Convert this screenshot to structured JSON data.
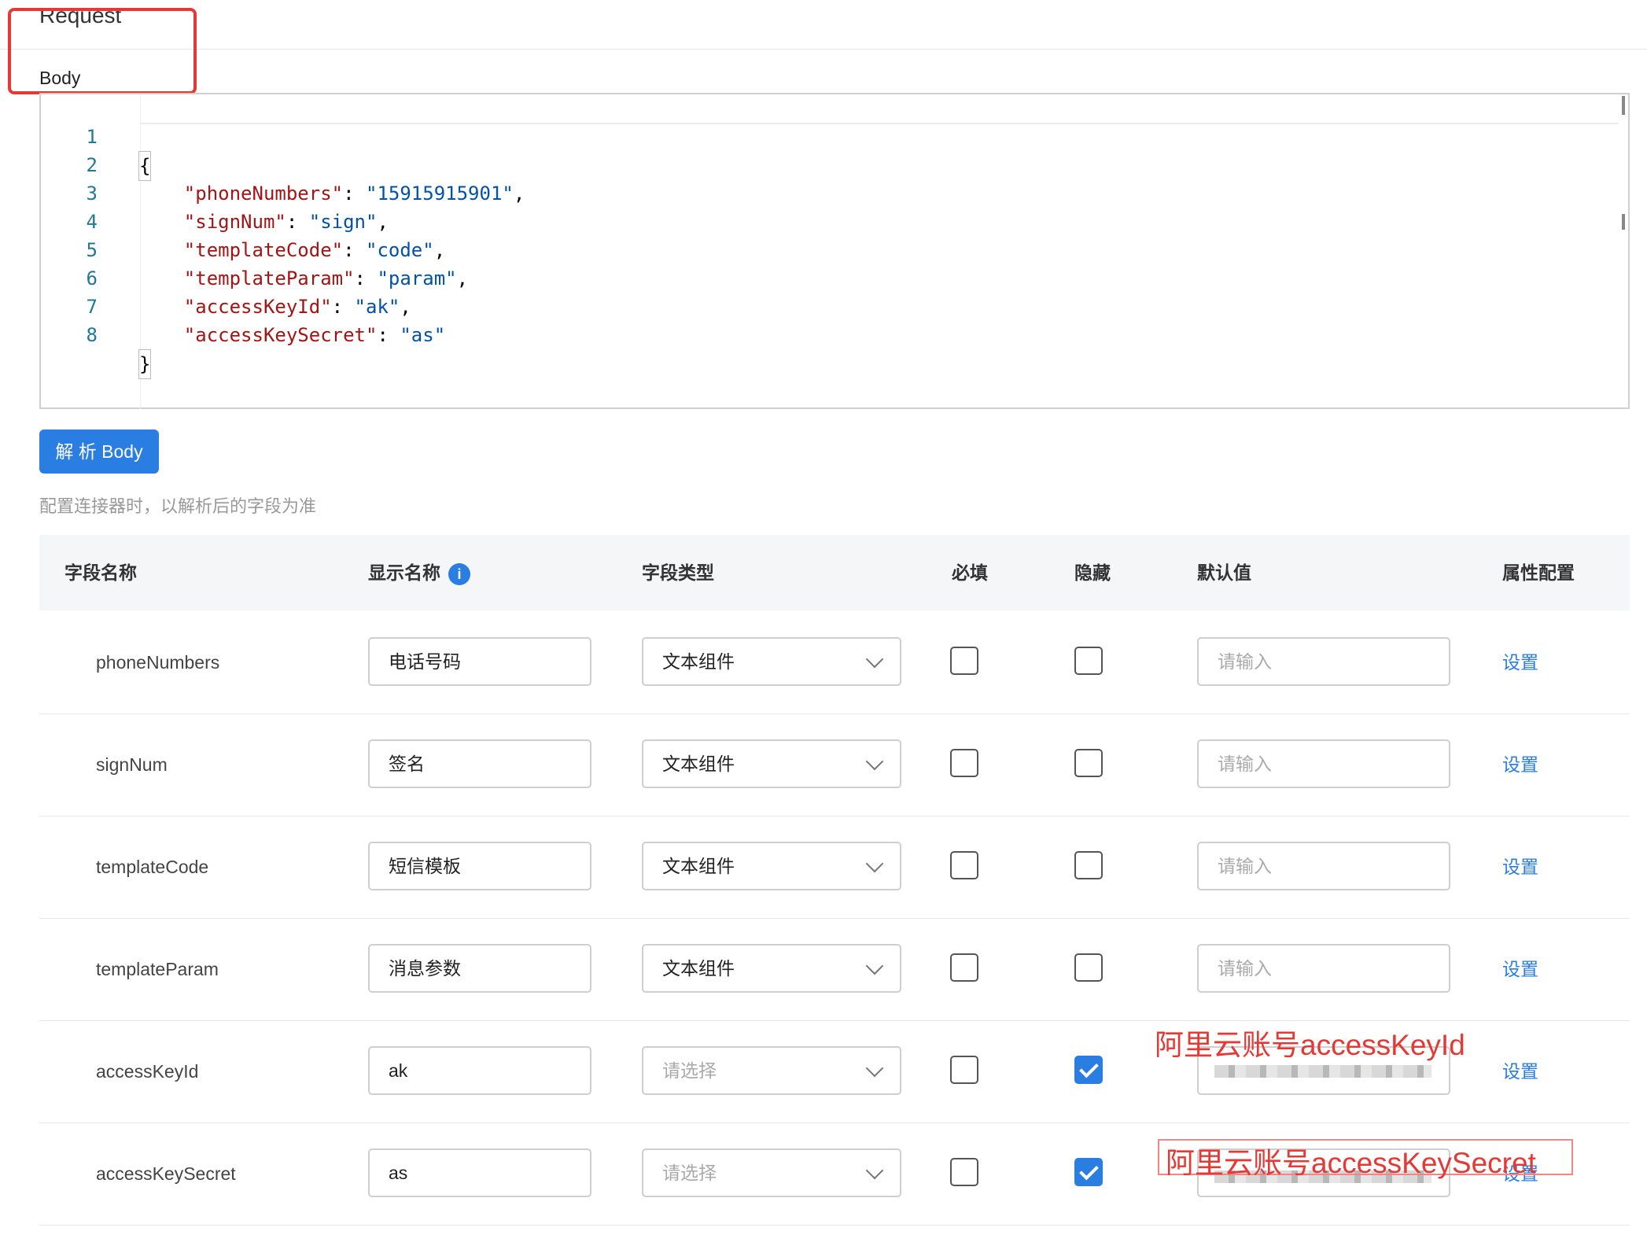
{
  "section": {
    "title": "Request",
    "body_label": "Body"
  },
  "editor": {
    "lines": [
      {
        "num": "1",
        "indent": "",
        "key": "",
        "value": "",
        "text": "{"
      },
      {
        "num": "2",
        "indent": "    ",
        "key": "\"phoneNumbers\"",
        "value": "\"15915915901\"",
        "trail": ","
      },
      {
        "num": "3",
        "indent": "    ",
        "key": "\"signNum\"",
        "value": "\"sign\"",
        "trail": ","
      },
      {
        "num": "4",
        "indent": "    ",
        "key": "\"templateCode\"",
        "value": "\"code\"",
        "trail": ","
      },
      {
        "num": "5",
        "indent": "    ",
        "key": "\"templateParam\"",
        "value": "\"param\"",
        "trail": ","
      },
      {
        "num": "6",
        "indent": "    ",
        "key": "\"accessKeyId\"",
        "value": "\"ak\"",
        "trail": ","
      },
      {
        "num": "7",
        "indent": "    ",
        "key": "\"accessKeySecret\"",
        "value": "\"as\"",
        "trail": ""
      },
      {
        "num": "8",
        "indent": "",
        "key": "",
        "value": "",
        "text": "}"
      }
    ]
  },
  "parse_button": "解 析 Body",
  "hint": "配置连接器时，以解析后的字段为准",
  "table": {
    "headers": {
      "field_name": "字段名称",
      "display_name": "显示名称",
      "display_info_icon": "i",
      "field_type": "字段类型",
      "required": "必填",
      "hidden": "隐藏",
      "default": "默认值",
      "attr": "属性配置"
    },
    "rows": [
      {
        "field": "phoneNumbers",
        "display": "电话号码",
        "type": "文本组件",
        "type_placeholder": false,
        "required": false,
        "hidden": false,
        "default_placeholder": "请输入",
        "action": "设置"
      },
      {
        "field": "signNum",
        "display": "签名",
        "type": "文本组件",
        "type_placeholder": false,
        "required": false,
        "hidden": false,
        "default_placeholder": "请输入",
        "action": "设置"
      },
      {
        "field": "templateCode",
        "display": "短信模板",
        "type": "文本组件",
        "type_placeholder": false,
        "required": false,
        "hidden": false,
        "default_placeholder": "请输入",
        "action": "设置"
      },
      {
        "field": "templateParam",
        "display": "消息参数",
        "type": "文本组件",
        "type_placeholder": false,
        "required": false,
        "hidden": false,
        "default_placeholder": "请输入",
        "action": "设置"
      },
      {
        "field": "accessKeyId",
        "display": "ak",
        "type": "请选择",
        "type_placeholder": true,
        "required": false,
        "hidden": true,
        "default_placeholder": "",
        "action": "设置"
      },
      {
        "field": "accessKeySecret",
        "display": "as",
        "type": "请选择",
        "type_placeholder": true,
        "required": false,
        "hidden": true,
        "default_placeholder": "",
        "action": "设置"
      }
    ]
  },
  "annotations": {
    "ak": "阿里云账号accessKeyId",
    "as": "阿里云账号accessKeySecret"
  },
  "colors": {
    "accent": "#2a7de1",
    "annotation": "#e53935",
    "json_key": "#a31515",
    "json_value": "#0451a5"
  }
}
